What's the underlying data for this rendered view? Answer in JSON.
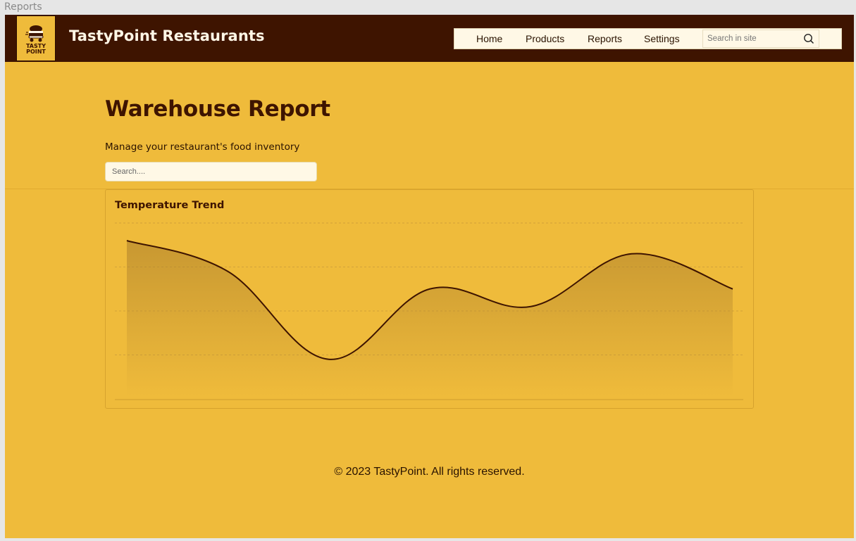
{
  "window": {
    "title": "Reports"
  },
  "header": {
    "logo_text": [
      "TASTY",
      "POINT"
    ],
    "brand": "TastyPoint Restaurants",
    "nav": [
      {
        "label": "Home"
      },
      {
        "label": "Products"
      },
      {
        "label": "Reports"
      },
      {
        "label": "Settings"
      }
    ],
    "search": {
      "placeholder": "Search in site",
      "icon": "search-icon"
    }
  },
  "main": {
    "title": "Warehouse Report",
    "subtitle": "Manage your restaurant's food inventory",
    "search": {
      "placeholder": "Search...."
    }
  },
  "chart_data": {
    "type": "area",
    "title": "Temperature Trend",
    "xlabel": "",
    "ylabel": "",
    "x": [
      0,
      1,
      2,
      3,
      4,
      5,
      6
    ],
    "values": [
      3.6,
      2.9,
      0.9,
      2.5,
      2.1,
      3.3,
      2.5
    ],
    "ylim": [
      0,
      4
    ],
    "grid": true,
    "line_color": "#3e1400",
    "fill_color": "#a87b2a",
    "curve": "smooth"
  },
  "footer": {
    "text": "© 2023 TastyPoint. All rights reserved."
  },
  "colors": {
    "background": "#efbb3b",
    "header": "#3e1400",
    "accent_text": "#3e1400",
    "nav_background": "#fff8e6"
  }
}
